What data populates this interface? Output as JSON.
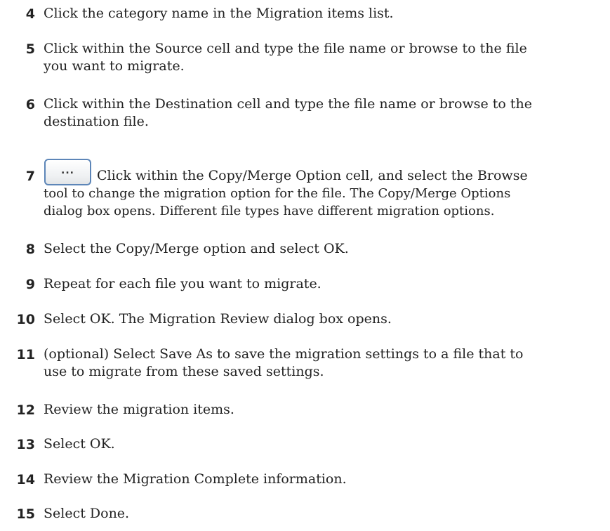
{
  "steps": [
    {
      "number": "4",
      "text": "Click the category name in the Migration items list."
    },
    {
      "number": "5",
      "line1": "Click within the Source cell and type the file name or browse to the file",
      "line2": "you want to migrate."
    },
    {
      "number": "6",
      "line1": "Click within the Destination cell and type the file name or browse to the",
      "line2": "destination file."
    },
    {
      "number": "7",
      "button_label": "...",
      "line1": "Click within the Copy/Merge Option cell, and select the Browse",
      "line2": "tool to change the migration option for the file. The Copy/Merge Options",
      "line3": "dialog box opens. Different file types have different migration options."
    },
    {
      "number": "8",
      "text": "Select the Copy/Merge option and select OK."
    },
    {
      "number": "9",
      "text": "Repeat for each file you want to migrate."
    },
    {
      "number": "10",
      "text": "Select OK. The Migration Review dialog box opens."
    },
    {
      "number": "11",
      "line1": "(optional) Select Save As to save the migration settings to a file that to",
      "line2": "use to migrate from these saved settings."
    },
    {
      "number": "12",
      "text": "Review the migration items."
    },
    {
      "number": "13",
      "text": "Select OK."
    },
    {
      "number": "14",
      "text": "Review the Migration Complete information."
    },
    {
      "number": "15",
      "text": "Select Done."
    }
  ]
}
